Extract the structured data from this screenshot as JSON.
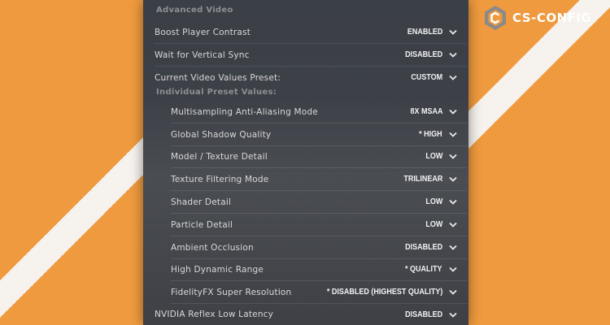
{
  "brand": {
    "name": "CS-CONFIG"
  },
  "section_heading": "Advanced Video",
  "subsection_heading": "Individual Preset Values:",
  "settings": [
    {
      "label": "Boost Player Contrast",
      "value": "ENABLED"
    },
    {
      "label": "Wait for Vertical Sync",
      "value": "DISABLED"
    },
    {
      "label": "Current Video Values Preset:",
      "value": "CUSTOM"
    },
    {
      "label": "Multisampling Anti-Aliasing Mode",
      "value": "8X MSAA"
    },
    {
      "label": "Global Shadow Quality",
      "value": "* HIGH"
    },
    {
      "label": "Model / Texture Detail",
      "value": "LOW"
    },
    {
      "label": "Texture Filtering Mode",
      "value": "TRILINEAR"
    },
    {
      "label": "Shader Detail",
      "value": "LOW"
    },
    {
      "label": "Particle Detail",
      "value": "LOW"
    },
    {
      "label": "Ambient Occlusion",
      "value": "DISABLED"
    },
    {
      "label": "High Dynamic Range",
      "value": "* QUALITY"
    },
    {
      "label": "FidelityFX Super Resolution",
      "value": "* DISABLED (HIGHEST QUALITY)"
    },
    {
      "label": "NVIDIA Reflex Low Latency",
      "value": "DISABLED"
    }
  ],
  "colors": {
    "background": "#ef9a3e",
    "panel": "#3d4047",
    "text": "#d8d8d8",
    "heading": "#8c8f94"
  }
}
